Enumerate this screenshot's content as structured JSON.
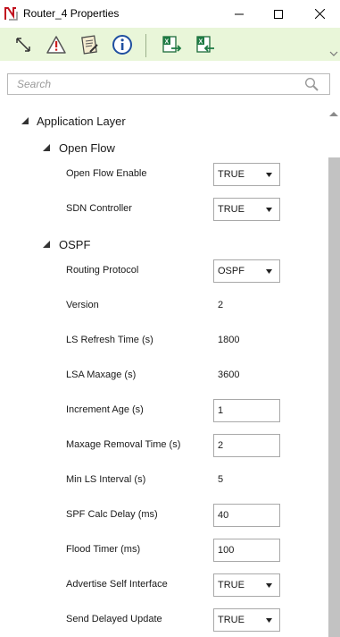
{
  "window": {
    "title": "Router_4 Properties",
    "controls": [
      "minimize",
      "maximize",
      "close"
    ]
  },
  "toolbar": {
    "icons": [
      "expand-collapse-icon",
      "warning-icon",
      "notes-icon",
      "info-icon",
      "export-excel-icon",
      "import-excel-icon"
    ],
    "background": "#e9f6d9"
  },
  "search": {
    "placeholder": "Search",
    "value": ""
  },
  "tree": {
    "root": {
      "label": "Application Layer",
      "groups": [
        {
          "label": "Open Flow",
          "properties": [
            {
              "label": "Open Flow Enable",
              "type": "dropdown",
              "value": "TRUE"
            },
            {
              "label": "SDN Controller",
              "type": "dropdown",
              "value": "TRUE"
            }
          ]
        },
        {
          "label": "OSPF",
          "properties": [
            {
              "label": "Routing Protocol",
              "type": "dropdown",
              "value": "OSPF"
            },
            {
              "label": "Version",
              "type": "readonly",
              "value": "2"
            },
            {
              "label": "LS Refresh Time (s)",
              "type": "readonly",
              "value": "1800"
            },
            {
              "label": "LSA Maxage (s)",
              "type": "readonly",
              "value": "3600"
            },
            {
              "label": "Increment Age (s)",
              "type": "text",
              "value": "1"
            },
            {
              "label": "Maxage Removal Time (s)",
              "type": "text",
              "value": "2"
            },
            {
              "label": "Min LS Interval (s)",
              "type": "readonly",
              "value": "5"
            },
            {
              "label": "SPF Calc Delay (ms)",
              "type": "text",
              "value": "40"
            },
            {
              "label": "Flood Timer (ms)",
              "type": "text",
              "value": "100"
            },
            {
              "label": "Advertise Self Interface",
              "type": "dropdown",
              "value": "TRUE"
            },
            {
              "label": "Send Delayed Update",
              "type": "dropdown",
              "value": "TRUE"
            }
          ]
        }
      ]
    }
  }
}
